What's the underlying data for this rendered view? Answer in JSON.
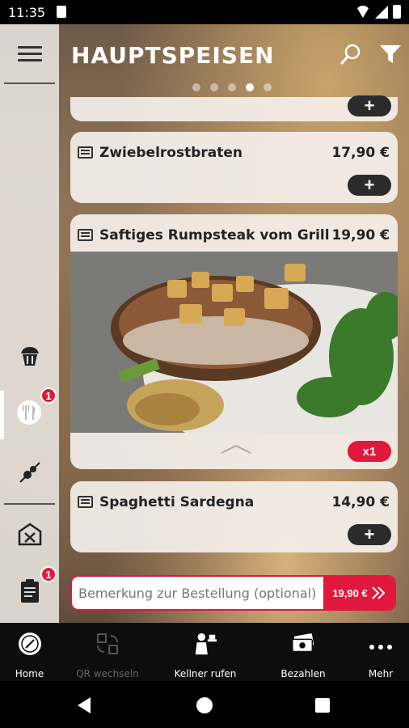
{
  "status_bar": {
    "time": "11:35"
  },
  "header": {
    "title": "HAUPTSPEISEN",
    "page_count": 5,
    "active_page": 4
  },
  "sidebar": {
    "items": [
      {
        "name": "dessert",
        "icon": "cupcake-icon"
      },
      {
        "name": "main-dishes",
        "icon": "fork-knife-icon",
        "badge": "1",
        "active": true
      },
      {
        "name": "skewer",
        "icon": "skewer-icon"
      },
      {
        "name": "restaurant",
        "icon": "restaurant-building-icon"
      },
      {
        "name": "order",
        "icon": "clipboard-icon",
        "badge": "1"
      }
    ]
  },
  "menu": {
    "items": [
      {
        "title": "Zwiebelrostbraten",
        "price": "17,90 €",
        "action": "+"
      },
      {
        "title": "Saftiges Rumpsteak vom Grill",
        "price": "19,90 €",
        "quantity": "x1"
      },
      {
        "title": "Spaghetti Sardegna",
        "price": "14,90 €",
        "action": "+"
      }
    ],
    "partial_top_action": "+"
  },
  "remark": {
    "placeholder": "Bemerkung zur Bestellung (optional)",
    "total": "19,90 €"
  },
  "bottom_nav": {
    "items": [
      {
        "label": "Home",
        "icon": "compass-icon"
      },
      {
        "label": "QR wechseln",
        "icon": "qr-swap-icon",
        "disabled": true
      },
      {
        "label": "Kellner rufen",
        "icon": "waiter-icon"
      },
      {
        "label": "Bezahlen",
        "icon": "money-icon"
      },
      {
        "label": "Mehr",
        "icon": "more-dots-icon"
      }
    ]
  },
  "colors": {
    "accent": "#e0183d",
    "dark_button": "#2b2b2b",
    "nav_bg": "#0d0d0d"
  }
}
